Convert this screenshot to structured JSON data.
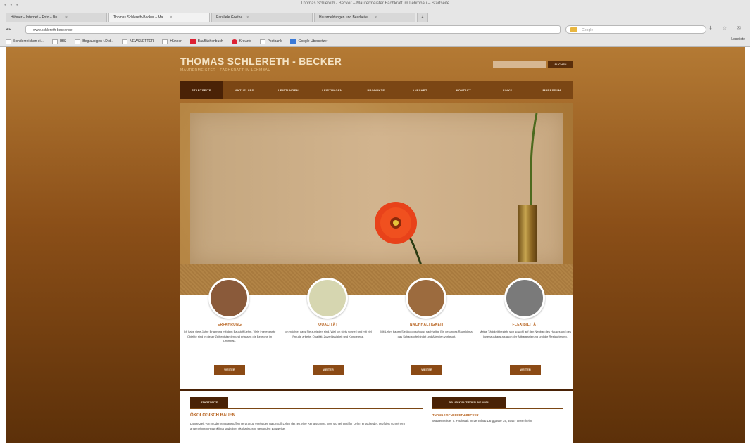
{
  "window": {
    "title": "Thomas Schlereth - Becker – Maurermeister Fachkraft im Lehmbau – Startseite"
  },
  "tabs": [
    {
      "label": "Hühner – Internet – Foto – Bru..."
    },
    {
      "label": "Thomas Schlereth-Becker – Ma..."
    },
    {
      "label": "Parallele Goethe"
    },
    {
      "label": "Hausmeldungen und Bearbeite..."
    }
  ],
  "address_bar": {
    "url": "www.schlereth-becker.de",
    "search_placeholder": "Google"
  },
  "bookmarks": [
    {
      "label": "Sonderzeichen ei...",
      "icon": "doc-icon"
    },
    {
      "label": "IBIS",
      "icon": "doc-icon"
    },
    {
      "label": "Beglaubigen f.D.d...",
      "icon": "doc-icon"
    },
    {
      "label": "NEWSLETTER",
      "icon": "doc-icon"
    },
    {
      "label": "Hühner",
      "icon": "doc-icon"
    },
    {
      "label": "Bauflächenbuch",
      "icon": "red-book-icon"
    },
    {
      "label": "Kreuzfs",
      "icon": "red-dot-icon"
    },
    {
      "label": "Postbank",
      "icon": "doc-icon"
    },
    {
      "label": "Google Übersetzer",
      "icon": "blue-icon"
    }
  ],
  "bookmarks_right": "Leseliste",
  "site": {
    "logo": "THOMAS SCHLERETH - BECKER",
    "tagline": "MAURERMEISTER · FACHKRAFT IM LEHMBAU",
    "search_button": "SUCHEN",
    "nav": [
      "STARTSEITE",
      "AKTUELLES",
      "LEISTUNGEN",
      "LEISTUNGEN",
      "PRODUKTE",
      "ANFAHRT",
      "KONTAKT",
      "LINKS",
      "IMPRESSUM"
    ],
    "features": [
      {
        "title": "ERFAHRUNG",
        "text": "Ich habe viele Jahre Erfahrung mit dem Baustoff Lehm. Viele interessante Objekte sind in dieser Zeit entstanden und erfassen die Bereiche im Lehmbau.",
        "button": "WEITER",
        "color": "#8a5a3a"
      },
      {
        "title": "QUALITÄT",
        "text": "Ich möchte, dass Sie zufrieden sind. Weil ich stets schnell und mit viel Freude arbeite. Qualität, Zuverlässigkeit und Kompetenz.",
        "button": "WEITER",
        "color": "#d6d6b0"
      },
      {
        "title": "NACHHALTIGKEIT",
        "text": "Mit Lehm bauen Sie ökologisch und nachhaltig. Ein gesundes Raumklima, das Schadstoffe bindet und Allergien vorbeugt.",
        "button": "WEITER",
        "color": "#9c6b3e"
      },
      {
        "title": "FLEXIBILITÄT",
        "text": "Meine Tätigkeit bezieht sich sowohl auf den Neubau des Hauses und des Innenausbaus als auch der Altbausanierung und die Restaurierung.",
        "button": "WEITER",
        "color": "#7a7a7a"
      }
    ],
    "content": {
      "tab": "STARTSEITE",
      "title": "ÖKOLOGISCH BAUEN",
      "text": "Lange Zeit von modernen Baustoffen verdrängt, erlebt der Naturstoff Lehm derzeit eine Renaissance. Wer sich einmal für Lehm entscheidet, profitiert von einem angenehmen Raumklima und einer ökologischen, gesunden Bauweise."
    },
    "sidebar": {
      "tab": "SO KONTAKTIEREN SIE MICH",
      "name": "THOMAS SCHLERETH-BECKER",
      "address": "Maurermeister u. Fachkraft im Lehmbau Langgasse 34, 35467 Dorenheim"
    }
  }
}
